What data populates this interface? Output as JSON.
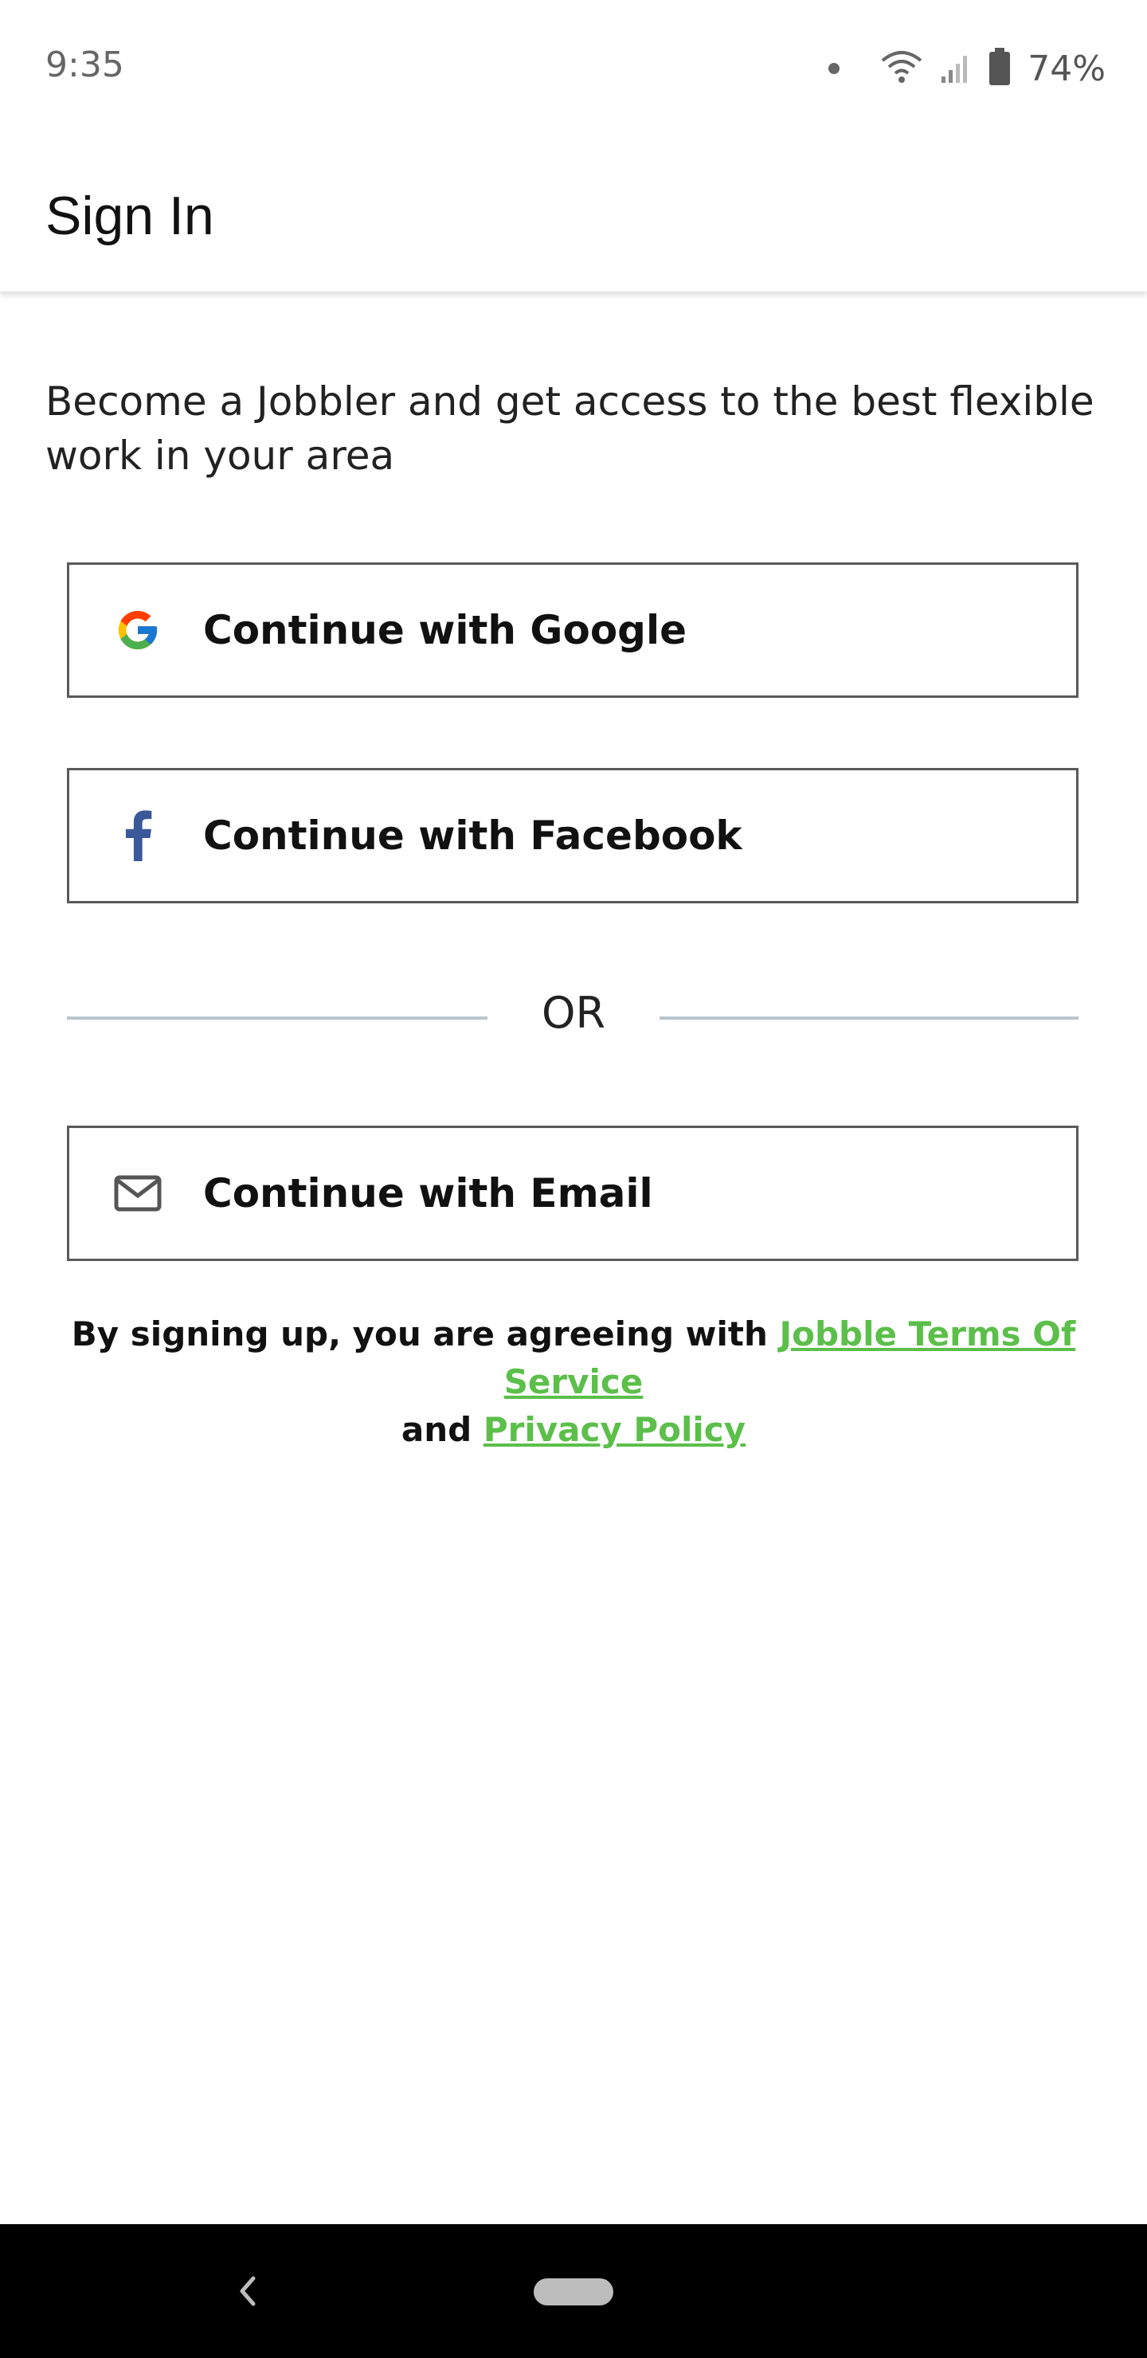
{
  "status_bar": {
    "time": "9:35",
    "battery_percent": "74%"
  },
  "header": {
    "title": "Sign In"
  },
  "intro_text": "Become a Jobbler and get access to the best flexible work in your area",
  "buttons": {
    "google": {
      "label": "Continue with Google",
      "icon": "google-icon"
    },
    "facebook": {
      "label": "Continue with Facebook",
      "icon": "facebook-icon"
    },
    "email": {
      "label": "Continue with Email",
      "icon": "mail-icon"
    }
  },
  "divider": {
    "label": "OR"
  },
  "legal": {
    "prefix": "By signing up, you are agreeing with ",
    "terms_link": "Jobble Terms Of Service",
    "middle": " and ",
    "privacy_link": "Privacy Policy"
  },
  "colors": {
    "link": "#5bbf4a",
    "facebook": "#3b5998",
    "button_border": "#5a5a5a",
    "divider": "#b9c4cc"
  }
}
